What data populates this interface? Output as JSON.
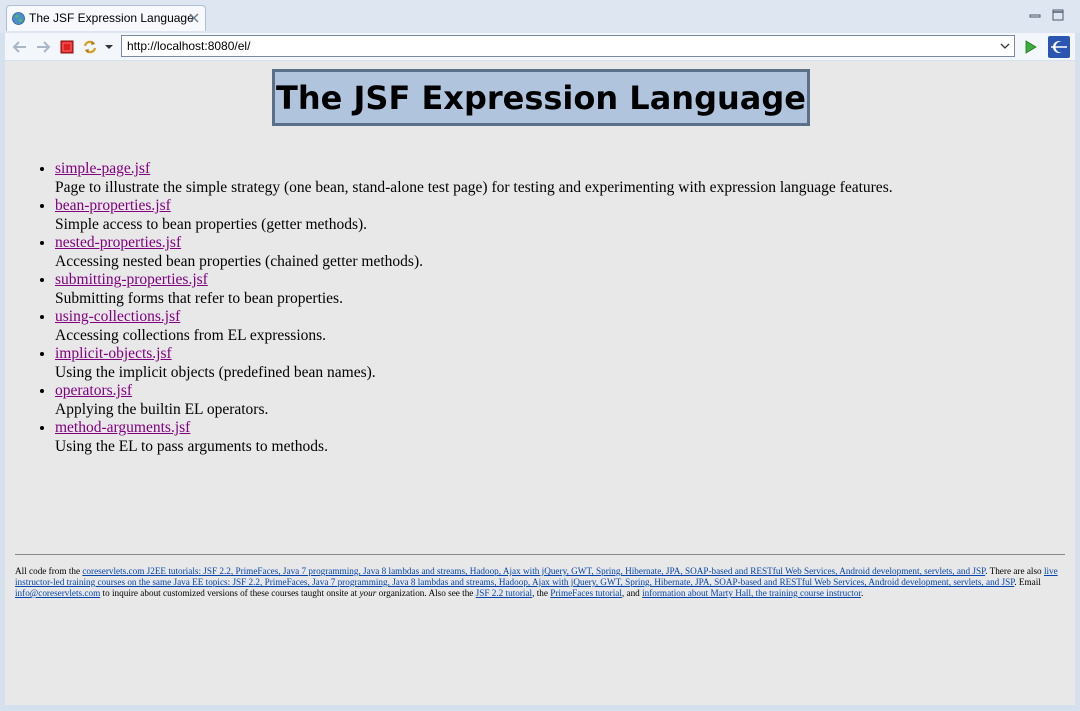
{
  "browser": {
    "tab_title": "The JSF Expression Language",
    "url": "http://localhost:8080/el/"
  },
  "page": {
    "heading": "The JSF Expression Language",
    "items": [
      {
        "link": "simple-page.jsf",
        "desc": "Page to illustrate the simple strategy (one bean, stand-alone test page) for testing and experimenting with expression language features."
      },
      {
        "link": "bean-properties.jsf",
        "desc": "Simple access to bean properties (getter methods)."
      },
      {
        "link": "nested-properties.jsf",
        "desc": "Accessing nested bean properties (chained getter methods)."
      },
      {
        "link": "submitting-properties.jsf",
        "desc": "Submitting forms that refer to bean properties."
      },
      {
        "link": "using-collections.jsf",
        "desc": "Accessing collections from EL expressions."
      },
      {
        "link": "implicit-objects.jsf",
        "desc": "Using the implicit objects (predefined bean names)."
      },
      {
        "link": "operators.jsf",
        "desc": "Applying the builtin EL operators."
      },
      {
        "link": "method-arguments.jsf",
        "desc": "Using the EL to pass arguments to methods."
      }
    ]
  },
  "footer": {
    "t1": "All code from the ",
    "l1": "coreservlets.com J2EE tutorials: JSF 2.2, PrimeFaces, Java 7 programming, Java 8 lambdas and streams, Hadoop, Ajax with jQuery, GWT, Spring, Hibernate, JPA, SOAP-based and RESTful Web Services, Android development, servlets, and JSP",
    "t2": ". There are also ",
    "l2": "live instructor-led training courses on the same Java EE topics: JSF 2.2, PrimeFaces, Java 7 programming, Java 8 lambdas and streams, Hadoop, Ajax with jQuery, GWT, Spring, Hibernate, JPA, SOAP-based and RESTful Web Services, Android development, servlets, and JSP",
    "t3": ". Email ",
    "l3": "info@coreservlets.com",
    "t4": " to inquire about customized versions of these courses taught onsite at ",
    "t4_em": "your",
    "t5": " organization. Also see the ",
    "l4": "JSF 2.2 tutorial",
    "t6": ", the ",
    "l5": "PrimeFaces tutorial",
    "t7": ", and ",
    "l6": "information about Marty Hall, the training course instructor",
    "t8": "."
  },
  "icons": {
    "tab": "globe-icon",
    "close": "close-icon",
    "minimize": "minimize-icon",
    "maximize": "maximize-icon",
    "back": "back-arrow-icon",
    "forward": "forward-arrow-icon",
    "stop": "stop-icon",
    "refresh": "refresh-icon",
    "menu": "dropdown-icon",
    "go": "go-icon",
    "extension": "eclipse-browser-icon"
  },
  "colors": {
    "heading_bg": "#b0c4de",
    "heading_border": "#5a7088",
    "visited_link": "#800080",
    "footer_link": "#0645ad",
    "content_bg": "#e8e8e8"
  }
}
